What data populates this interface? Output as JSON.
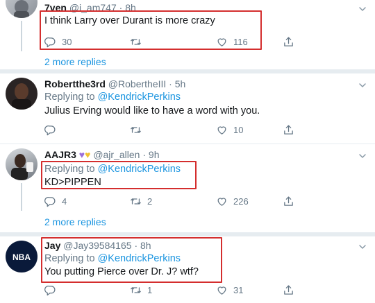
{
  "tweets": [
    {
      "name": "7ven",
      "handle": "@i_am747",
      "time": "8h",
      "body": "I think Larry over Durant is more crazy",
      "replies": "30",
      "retweets": "",
      "likes": "116"
    },
    {
      "name": "Robertthe3rd",
      "handle": "@RobertheIII",
      "time": "5h",
      "replying_label": "Replying to",
      "replying_to": "@KendrickPerkins",
      "body": "Julius Erving would like to have a word with you.",
      "replies": "",
      "retweets": "",
      "likes": "10"
    },
    {
      "name": "AAJR3",
      "handle": "@ajr_allen",
      "time": "9h",
      "replying_label": "Replying to",
      "replying_to": "@KendrickPerkins",
      "body": "KD>PIPPEN",
      "replies": "4",
      "retweets": "2",
      "likes": "226"
    },
    {
      "name": "Jay",
      "handle": "@Jay39584165",
      "time": "8h",
      "avatar_text": "NBA",
      "replying_label": "Replying to",
      "replying_to": "@KendrickPerkins",
      "body": "You putting Pierce over Dr. J? wtf?",
      "replies": "",
      "retweets": "1",
      "likes": "31"
    }
  ],
  "more_replies": [
    "2 more replies",
    "2 more replies"
  ],
  "separator_dot": "·",
  "colors": {
    "highlight": "#d42e2e",
    "link": "#1b95e0",
    "muted": "#657786"
  }
}
